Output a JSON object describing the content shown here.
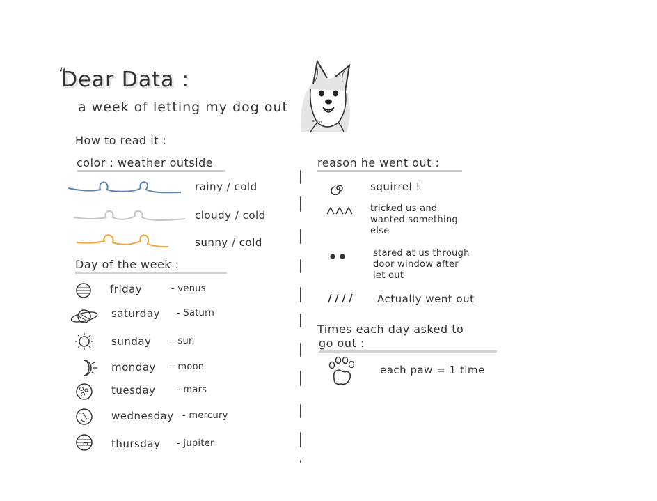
{
  "header": {
    "quote_mark": "“",
    "title": "Dear Data :",
    "subtitle": "a week of letting my dog out",
    "dog_caption": "Echo"
  },
  "legend_left": {
    "how_to_read": "How to read it :",
    "color_heading": "color : weather outside",
    "weather": [
      {
        "label": "rainy / cold",
        "color": "#5a85b3"
      },
      {
        "label": "cloudy / cold",
        "color": "#c4c4c4"
      },
      {
        "label": "sunny / cold",
        "color": "#f2a53a"
      }
    ],
    "day_heading": "Day of the week :",
    "days": [
      {
        "day": "friday",
        "planet": "- venus",
        "icon": "venus-icon"
      },
      {
        "day": "saturday",
        "planet": "- Saturn",
        "icon": "saturn-icon"
      },
      {
        "day": "sunday",
        "planet": "- sun",
        "icon": "sun-icon"
      },
      {
        "day": "monday",
        "planet": "- moon",
        "icon": "moon-icon"
      },
      {
        "day": "tuesday",
        "planet": "- mars",
        "icon": "mars-icon"
      },
      {
        "day": "wednesday",
        "planet": "- mercury",
        "icon": "mercury-icon"
      },
      {
        "day": "thursday",
        "planet": "- jupiter",
        "icon": "jupiter-icon"
      }
    ]
  },
  "legend_right": {
    "reason_heading": "reason he went out :",
    "reasons": [
      {
        "symbol": "@",
        "lines": [
          "squirrel !"
        ],
        "icon": "spiral-icon"
      },
      {
        "symbol": "^^^",
        "lines": [
          "tricked us and",
          "wanted something",
          "else"
        ],
        "icon": "carets-icon"
      },
      {
        "symbol": "••",
        "lines": [
          "stared at us through",
          "door window after",
          "let out"
        ],
        "icon": "dots-icon"
      },
      {
        "symbol": "////",
        "lines": [
          "Actually went out"
        ],
        "icon": "slashes-icon"
      }
    ],
    "times_heading_line1": "Times each day asked to",
    "times_heading_line2": "go out :",
    "paw_label": "each paw = 1 time"
  }
}
